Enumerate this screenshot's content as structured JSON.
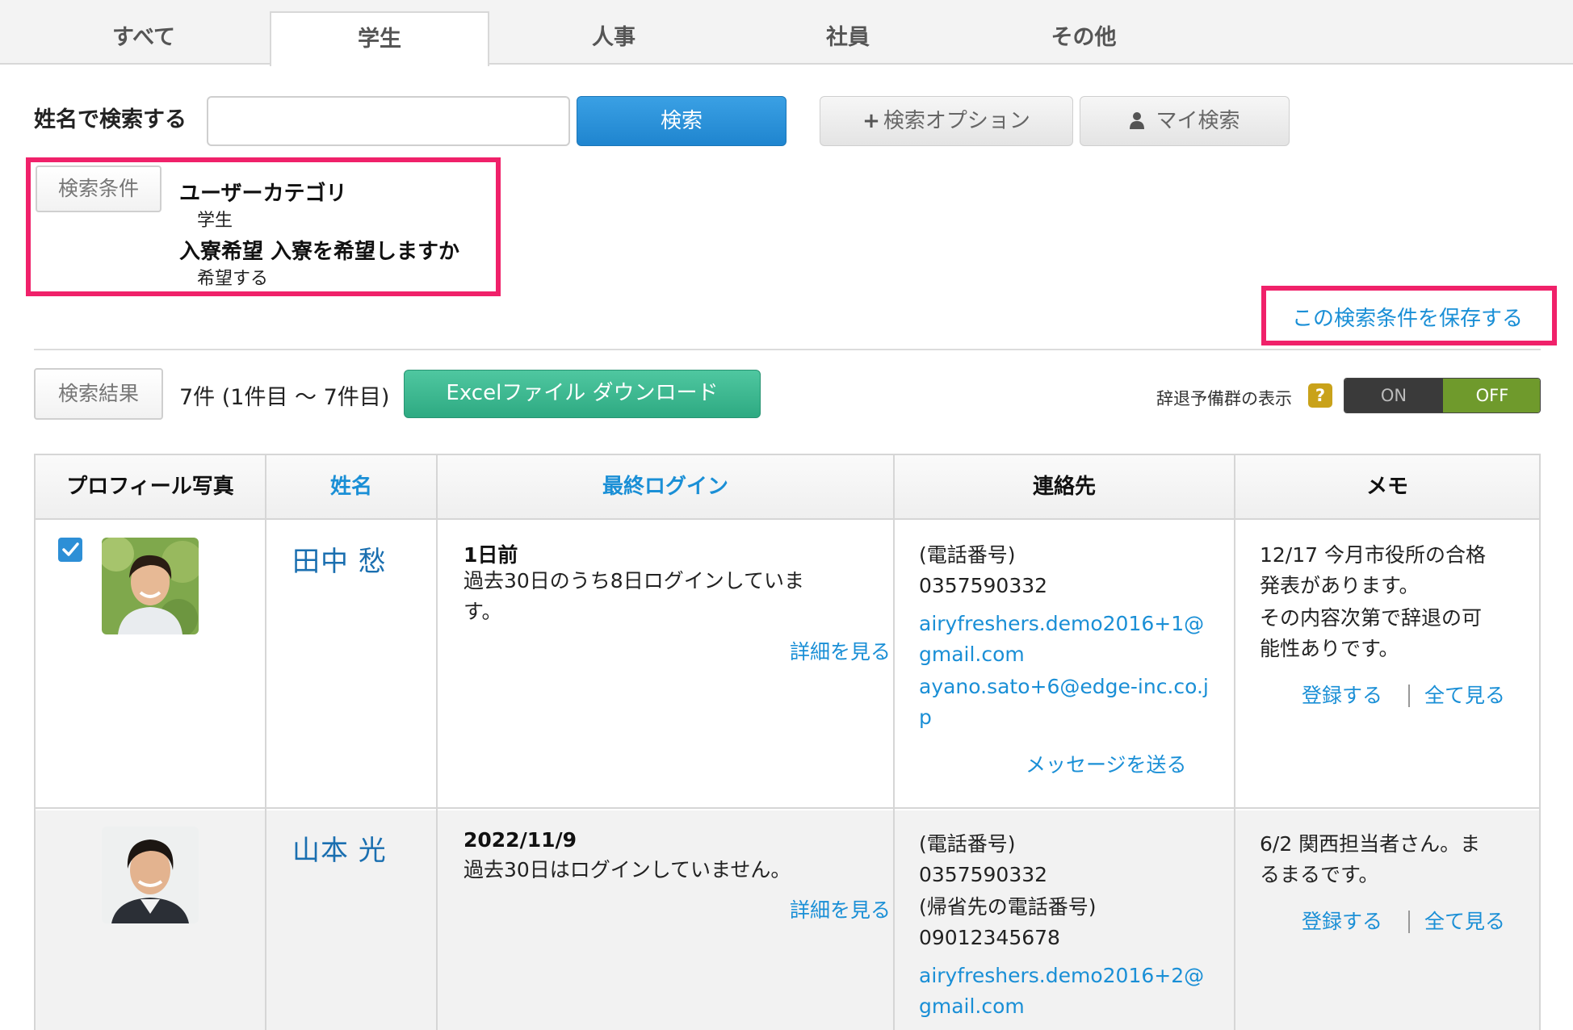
{
  "tabs": [
    "すべて",
    "学生",
    "人事",
    "社員",
    "その他"
  ],
  "search": {
    "label": "姓名で検索する",
    "input_value": "",
    "search_button": "検索",
    "option_button": "検索オプション",
    "option_icon": "plus-icon",
    "mysearch_button": "マイ検索",
    "mysearch_icon": "user-icon"
  },
  "conditions": {
    "tag": "検索条件",
    "items": [
      {
        "title": "ユーザーカテゴリ",
        "value": "学生"
      },
      {
        "title": "入寮希望 入寮を希望しますか",
        "value": "希望する"
      }
    ],
    "save_link": "この検索条件を保存する",
    "highlight_color": "#f0216a"
  },
  "results": {
    "tag": "検索結果",
    "count": "7件 (1件目 〜 7件目)",
    "excel_button": "Excelファイル ダウンロード",
    "withdraw_label": "辞退予備群の表示",
    "help_icon": "?",
    "toggle_on": "ON",
    "toggle_off": "OFF",
    "toggle_state": "OFF"
  },
  "table": {
    "headers": [
      "プロフィール写真",
      "姓名",
      "最終ログイン",
      "連絡先",
      "メモ"
    ],
    "rows": [
      {
        "checked": true,
        "name": "田中 愁",
        "last_login": "1日前",
        "login_note_1": "過去30日のうち8日ログインしていま",
        "login_note_2": "す。",
        "detail_link": "詳細を見る",
        "phone_label": "(電話番号)",
        "phone": "0357590332",
        "email_1a": "airyfreshers.demo2016+1@",
        "email_1b": "gmail.com",
        "email_2a": "ayano.sato+6@edge-inc.co.j",
        "email_2b": "p",
        "message_link": "メッセージを送る",
        "memo_1": "12/17 今月市役所の合格",
        "memo_2": "発表があります。",
        "memo_3": "その内容次第で辞退の可",
        "memo_4": "能性ありです。",
        "register_link": "登録する",
        "viewall_link": "全て見る"
      },
      {
        "checked": false,
        "name": "山本 光",
        "last_login": "2022/11/9",
        "login_note_1": "過去30日はログインしていません。",
        "detail_link": "詳細を見る",
        "phone_label": "(電話番号)",
        "phone": "0357590332",
        "home_phone_label": "(帰省先の電話番号)",
        "home_phone": "09012345678",
        "email_1a": "airyfreshers.demo2016+2@",
        "email_1b": "gmail.com",
        "memo_1": "6/2 関西担当者さん。ま",
        "memo_2": "るまるです。",
        "register_link": "登録する",
        "viewall_link": "全て見る"
      }
    ]
  }
}
